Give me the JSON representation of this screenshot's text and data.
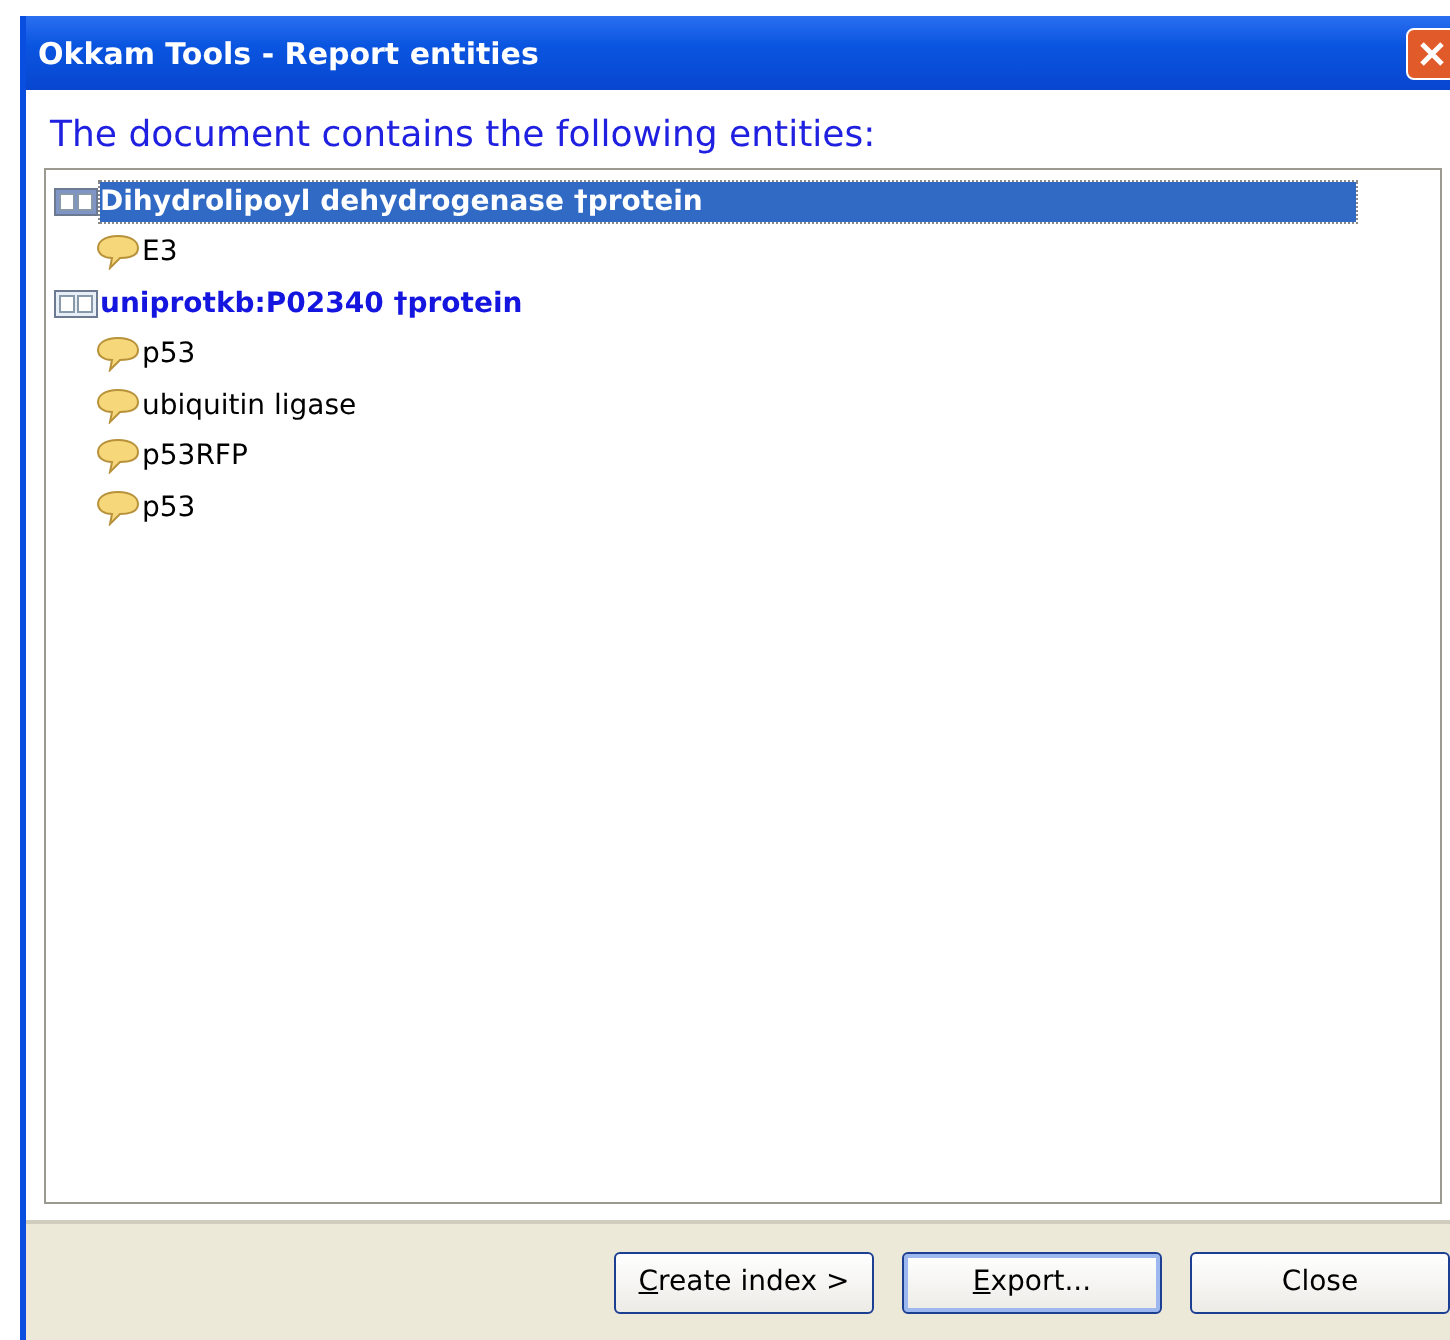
{
  "window": {
    "title": "Okkam Tools - Report entities"
  },
  "heading": "The document contains the following entities:",
  "tree": [
    {
      "kind": "entity",
      "label": "Dihydrolipoyl dehydrogenase †protein",
      "selected": true,
      "children": [
        {
          "kind": "name",
          "label": "E3",
          "selected": false
        }
      ]
    },
    {
      "kind": "entity",
      "label": "uniprotkb:P02340 †protein",
      "selected": false,
      "children": [
        {
          "kind": "name",
          "label": "p53",
          "selected": false
        },
        {
          "kind": "name",
          "label": "ubiquitin ligase",
          "selected": false
        },
        {
          "kind": "name",
          "label": "p53RFP",
          "selected": false
        },
        {
          "kind": "name",
          "label": "p53",
          "selected": false
        }
      ]
    }
  ],
  "buttons": [
    {
      "label": "Create index >",
      "underline_first": true,
      "default": false
    },
    {
      "label": "Export...",
      "underline_first": true,
      "default": true
    },
    {
      "label": "Close",
      "underline_first": false,
      "default": false
    }
  ]
}
